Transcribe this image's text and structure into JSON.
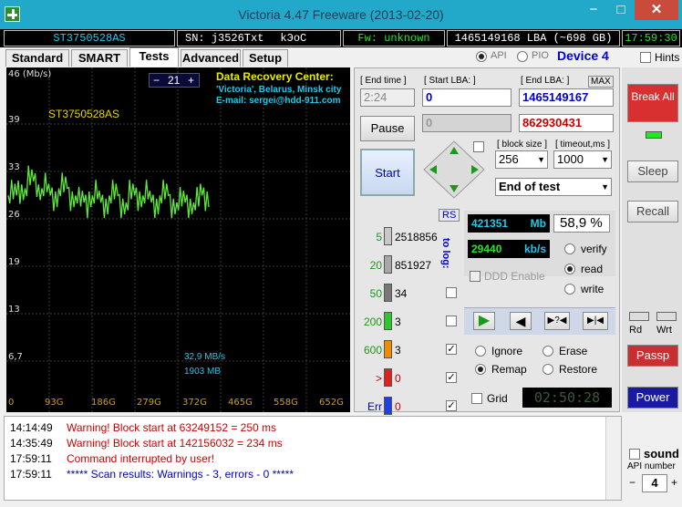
{
  "window": {
    "title": "Victoria 4.47  Freeware (2013-02-20)",
    "min": "−",
    "max": "□",
    "close": "✕"
  },
  "infobar": {
    "model": "ST3750528AS",
    "serial": "SN: j3526Txt",
    "code": "kЭoC",
    "firmware": "Fw: unknown",
    "lba": "1465149168 LBA (~698 GB)",
    "clock": "17:59:30"
  },
  "tabs": [
    "Standard",
    "SMART",
    "Tests",
    "Advanced",
    "Setup"
  ],
  "mode": {
    "api_label": "API",
    "pio_label": "PIO",
    "device": "Device 4",
    "hints": "Hints"
  },
  "graph": {
    "speed_unit": "46 (Mb/s)",
    "drive": "ST3750528AS",
    "scale": "21",
    "minus": "−",
    "plus": "+",
    "drc_title": "Data Recovery Center:",
    "drc_line1": "'Victoria', Belarus, Minsk city",
    "drc_line2": "E-mail: sergei@hdd-911.com",
    "current_speed": "32,9 MB/s",
    "current_pos": "1903 MB",
    "y_ticks": [
      "46",
      "39",
      "33",
      "26",
      "19",
      "13",
      "6,7"
    ],
    "x_ticks": [
      "0",
      "93G",
      "186G",
      "279G",
      "372G",
      "465G",
      "558G",
      "652G"
    ]
  },
  "chart_data": {
    "type": "line",
    "xlabel": "",
    "ylabel": "",
    "ylim": [
      0,
      46
    ],
    "xlim_gb": [
      0,
      698
    ],
    "series": [
      {
        "values_approx_mbs": [
          29,
          30,
          31,
          30,
          29,
          30,
          29,
          28,
          29,
          28,
          29,
          28,
          29,
          29,
          28,
          29,
          28,
          28,
          28,
          29
        ]
      }
    ]
  },
  "test": {
    "end_time_label": "[ End time ]",
    "end_time": "2:24",
    "start_lba_label": "[ Start LBA: ]",
    "start_lba": "0",
    "end_lba_label": "[ End LBA: ]",
    "max_label": "MAX",
    "end_lba": "1465149167",
    "progress_lba": "0",
    "current_lba": "862930431",
    "pause": "Pause",
    "start": "Start",
    "block_size_label": "[ block size ]",
    "block_size": "256",
    "timeout_label": "[ timeout,ms ]",
    "timeout": "1000",
    "end_action": "End of test"
  },
  "stats": {
    "rs": "RS",
    "tolog": "to log:",
    "rows": [
      {
        "label": "5",
        "count": "2518856",
        "color": "#c8c8c8"
      },
      {
        "label": "20",
        "count": "851927",
        "color": "#a8a8a8"
      },
      {
        "label": "50",
        "count": "34",
        "color": "#787878"
      },
      {
        "label": "200",
        "count": "3",
        "color": "#2ec82e"
      },
      {
        "label": "600",
        "count": "3",
        "color": "#f08c00"
      },
      {
        "label": ">",
        "count": "0",
        "color": "#e02020"
      },
      {
        "label": "Err",
        "count": "0",
        "color": "#2040e0"
      }
    ]
  },
  "progress": {
    "mb": "421351",
    "mb_unit": "Mb",
    "percent": "58,9",
    "pct_sign": "%",
    "speed": "29440",
    "speed_unit": "kb/s",
    "ddd": "DDD Enable",
    "verify": "verify",
    "read": "read",
    "write": "write",
    "ignore": "Ignore",
    "erase": "Erase",
    "remap": "Remap",
    "restore": "Restore",
    "grid": "Grid",
    "timer": "02:50:28",
    "btn_play": "▶",
    "btn_back": "◀",
    "btn_skip": "▶?◀",
    "btn_end": "▶|◀"
  },
  "side": {
    "break_all": "Break All",
    "sleep": "Sleep",
    "recall": "Recall",
    "rd": "Rd",
    "wrt": "Wrt",
    "passp": "Passp",
    "power": "Power",
    "sound": "sound",
    "api_number": "API number",
    "api_value": "4",
    "api_minus": "−",
    "api_plus": "+"
  },
  "log": [
    {
      "time": "14:14:49",
      "text": "Warning! Block start at 63249152 = 250 ms",
      "color": "#d00000"
    },
    {
      "time": "14:35:49",
      "text": "Warning! Block start at 142156032 = 234 ms",
      "color": "#d00000"
    },
    {
      "time": "17:59:11",
      "text": "Command interrupted by user!",
      "color": "#d00000"
    },
    {
      "time": "17:59:11",
      "text": "***** Scan results: Warnings - 3, errors - 0 *****",
      "color": "#0000c8"
    }
  ]
}
